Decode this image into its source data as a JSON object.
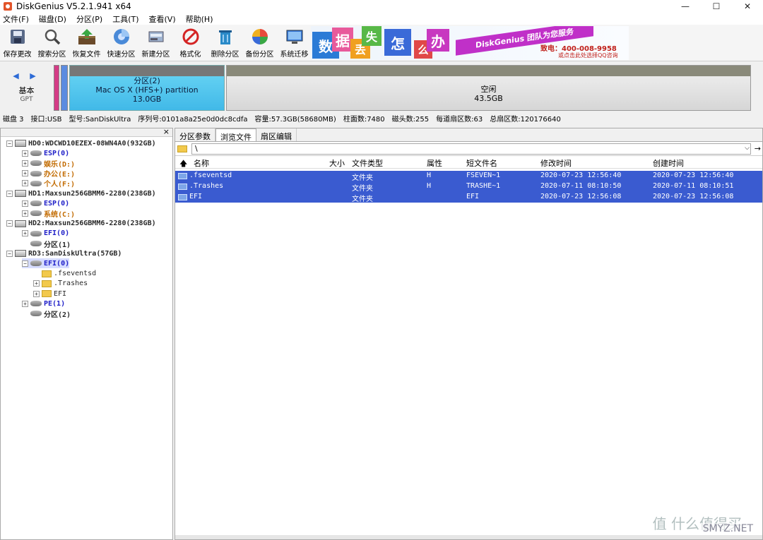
{
  "window": {
    "title": "DiskGenius V5.2.1.941 x64",
    "controls": [
      "—",
      "☐",
      "✕"
    ]
  },
  "menu": [
    "文件(F)",
    "磁盘(D)",
    "分区(P)",
    "工具(T)",
    "查看(V)",
    "帮助(H)"
  ],
  "toolbar": [
    {
      "label": "保存更改",
      "icon": "save-icon"
    },
    {
      "label": "搜索分区",
      "icon": "magnifier-icon"
    },
    {
      "label": "恢复文件",
      "icon": "restore-file-icon"
    },
    {
      "label": "快速分区",
      "icon": "quick-partition-icon"
    },
    {
      "label": "新建分区",
      "icon": "new-partition-icon"
    },
    {
      "label": "格式化",
      "icon": "format-icon"
    },
    {
      "label": "删除分区",
      "icon": "delete-partition-icon"
    },
    {
      "label": "备份分区",
      "icon": "backup-partition-icon"
    },
    {
      "label": "系统迁移",
      "icon": "system-migrate-icon"
    }
  ],
  "banner": {
    "tiles": [
      "数",
      "据",
      "丢",
      "失",
      "怎",
      "么",
      "办"
    ],
    "ribbon": "DiskGenius 团队为您服务",
    "phone": "致电：400-008-9958",
    "sub": "或点击此处选择QQ咨询",
    "colors": [
      "#2b7bd6",
      "#e85a9b",
      "#58b847",
      "#f0a020",
      "#3a6ad8",
      "#e04848",
      "#c838c0"
    ]
  },
  "disk_nav": {
    "arrows": "◀ ▶",
    "type": "基本",
    "style": "GPT"
  },
  "disk_bar": {
    "mac_partition": {
      "name": "分区(2)",
      "fs": "Mac OS X (HFS+) partition",
      "size": "13.0GB"
    },
    "free_space": {
      "name": "空闲",
      "size": "43.5GB"
    }
  },
  "disk_info": [
    "磁盘 3",
    "接口:USB",
    "型号:SanDiskUltra",
    "序列号:0101a8a25e0d0dc8cdfa",
    "容量:57.3GB(58680MB)",
    "柱面数:7480",
    "磁头数:255",
    "每道扇区数:63",
    "总扇区数:120176640"
  ],
  "tree": {
    "close": "×",
    "nodes": [
      {
        "label": "HD0:WDCWD10EZEX-08WN4A0(932GB)",
        "level": 0,
        "kind": "disk",
        "exp": "−",
        "color": "c-green"
      },
      {
        "label": "ESP(0)",
        "level": 1,
        "kind": "part",
        "exp": "+",
        "color": "c-blue"
      },
      {
        "label": "娱乐(D:)",
        "level": 1,
        "kind": "part",
        "exp": "+",
        "color": "c-orange"
      },
      {
        "label": "办公(E:)",
        "level": 1,
        "kind": "part",
        "exp": "+",
        "color": "c-orange"
      },
      {
        "label": "个人(F:)",
        "level": 1,
        "kind": "part",
        "exp": "+",
        "color": "c-orange"
      },
      {
        "label": "HD1:Maxsun256GBMM6-2280(238GB)",
        "level": 0,
        "kind": "disk",
        "exp": "−",
        "color": "c-green"
      },
      {
        "label": "ESP(0)",
        "level": 1,
        "kind": "part",
        "exp": "+",
        "color": "c-blue"
      },
      {
        "label": "系统(C:)",
        "level": 1,
        "kind": "part",
        "exp": "+",
        "color": "c-orange"
      },
      {
        "label": "HD2:Maxsun256GBMM6-2280(238GB)",
        "level": 0,
        "kind": "disk",
        "exp": "−",
        "color": "c-green"
      },
      {
        "label": "EFI(0)",
        "level": 1,
        "kind": "part",
        "exp": "+",
        "color": "c-blue"
      },
      {
        "label": "分区(1)",
        "level": 1,
        "kind": "part",
        "exp": "",
        "color": "c-green"
      },
      {
        "label": "RD3:SanDiskUltra(57GB)",
        "level": 0,
        "kind": "disk",
        "exp": "−",
        "color": "c-green"
      },
      {
        "label": "EFI(0)",
        "level": 1,
        "kind": "part",
        "exp": "−",
        "color": "c-blue",
        "selected": true
      },
      {
        "label": ".fseventsd",
        "level": 2,
        "kind": "folder",
        "exp": "",
        "color": "c-green"
      },
      {
        "label": ".Trashes",
        "level": 2,
        "kind": "folder",
        "exp": "+",
        "color": "c-green"
      },
      {
        "label": "EFI",
        "level": 2,
        "kind": "folder",
        "exp": "+",
        "color": "c-green"
      },
      {
        "label": "PE(1)",
        "level": 1,
        "kind": "part",
        "exp": "+",
        "color": "c-blue"
      },
      {
        "label": "分区(2)",
        "level": 1,
        "kind": "part",
        "exp": "",
        "color": "c-green"
      }
    ]
  },
  "tabs": [
    "分区参数",
    "浏览文件",
    "扇区编辑"
  ],
  "active_tab": 1,
  "path": {
    "value": "\\"
  },
  "columns": [
    "名称",
    "大小",
    "文件类型",
    "属性",
    "短文件名",
    "修改时间",
    "创建时间"
  ],
  "files": [
    {
      "name": ".fseventsd",
      "size": "",
      "type": "文件夹",
      "attr": "H",
      "short": "FSEVEN~1",
      "modified": "2020-07-23 12:56:40",
      "created": "2020-07-23 12:56:40"
    },
    {
      "name": ".Trashes",
      "size": "",
      "type": "文件夹",
      "attr": "H",
      "short": "TRASHE~1",
      "modified": "2020-07-11 08:10:50",
      "created": "2020-07-11 08:10:51"
    },
    {
      "name": "EFI",
      "size": "",
      "type": "文件夹",
      "attr": "",
      "short": "EFI",
      "modified": "2020-07-23 12:56:08",
      "created": "2020-07-23 12:56:08"
    }
  ],
  "watermark": {
    "main": "值 什么值得买",
    "sub": "SMYZ.NET"
  }
}
